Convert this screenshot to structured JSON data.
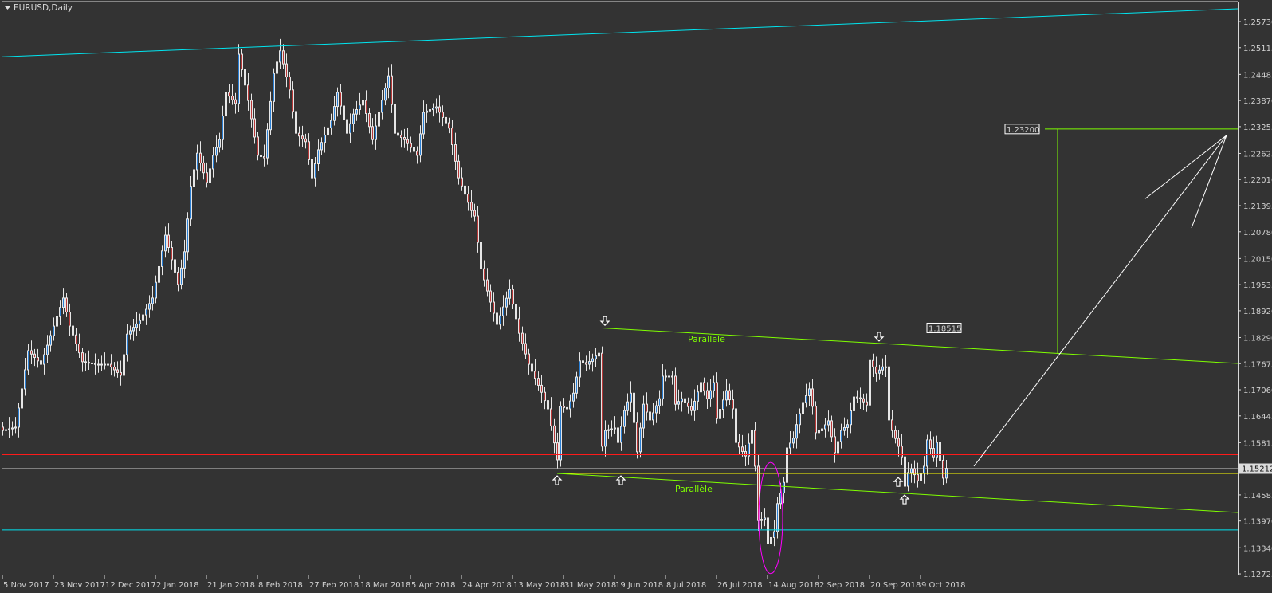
{
  "header": {
    "title": "EURUSD,Daily",
    "menu_icon": "triangle-down-icon"
  },
  "colors": {
    "background": "#333333",
    "axis": "#d8d8d8",
    "bull_fill": "#2a7fd4",
    "bear_fill": "#b83838",
    "candle_outline": "#e6e6e6",
    "trendline_cyan": "#00e5f0",
    "support_red": "#ff1a1a",
    "bid_gray": "#808080",
    "level_yellow": "#ffff00",
    "channel_green": "#7fff00",
    "ellipse_magenta": "#ff00ff",
    "arrow_white": "#ffffff"
  },
  "chart_data": {
    "type": "candlestick",
    "symbol": "EURUSD",
    "timeframe": "Daily",
    "ylim": [
      1.12725,
      1.2573
    ],
    "y_ticks": [
      "1.25730",
      "1.25115",
      "1.24485",
      "1.23870",
      "1.23255",
      "1.22625",
      "1.22010",
      "1.21395",
      "1.20780",
      "1.20150",
      "1.19535",
      "1.18920",
      "1.18290",
      "1.17675",
      "1.17060",
      "1.16445",
      "1.15815",
      "1.14585",
      "1.13970",
      "1.13340",
      "1.12725"
    ],
    "x_ticks": [
      {
        "bar": 0,
        "label": "5 Nov 2017"
      },
      {
        "bar": 16,
        "label": "23 Nov 2017"
      },
      {
        "bar": 32,
        "label": "12 Dec 2017"
      },
      {
        "bar": 48,
        "label": "2 Jan 2018"
      },
      {
        "bar": 64,
        "label": "21 Jan 2018"
      },
      {
        "bar": 80,
        "label": "8 Feb 2018"
      },
      {
        "bar": 96,
        "label": "27 Feb 2018"
      },
      {
        "bar": 112,
        "label": "18 Mar 2018"
      },
      {
        "bar": 128,
        "label": "5 Apr 2018"
      },
      {
        "bar": 144,
        "label": "24 Apr 2018"
      },
      {
        "bar": 160,
        "label": "13 May 2018"
      },
      {
        "bar": 176,
        "label": "31 May 2018"
      },
      {
        "bar": 192,
        "label": "19 Jun 2018"
      },
      {
        "bar": 208,
        "label": "8 Jul 2018"
      },
      {
        "bar": 224,
        "label": "26 Jul 2018"
      },
      {
        "bar": 240,
        "label": "14 Aug 2018"
      },
      {
        "bar": 256,
        "label": "2 Sep 2018"
      },
      {
        "bar": 272,
        "label": "20 Sep 2018"
      },
      {
        "bar": 288,
        "label": "9 Oct 2018"
      }
    ],
    "bars_total": 297,
    "close_keypoints": [
      [
        0,
        1.161
      ],
      [
        4,
        1.1618
      ],
      [
        8,
        1.1798
      ],
      [
        12,
        1.1766
      ],
      [
        16,
        1.1856
      ],
      [
        19,
        1.1922
      ],
      [
        21,
        1.1856
      ],
      [
        25,
        1.1772
      ],
      [
        29,
        1.1766
      ],
      [
        33,
        1.1766
      ],
      [
        37,
        1.174
      ],
      [
        39,
        1.1837
      ],
      [
        43,
        1.1869
      ],
      [
        47,
        1.1922
      ],
      [
        51,
        1.207
      ],
      [
        55,
        1.1954
      ],
      [
        57,
        1.2031
      ],
      [
        59,
        1.2185
      ],
      [
        61,
        1.2263
      ],
      [
        64,
        1.2194
      ],
      [
        66,
        1.2258
      ],
      [
        68,
        1.2295
      ],
      [
        70,
        1.2406
      ],
      [
        73,
        1.238
      ],
      [
        74,
        1.2496
      ],
      [
        77,
        1.2387
      ],
      [
        80,
        1.2258
      ],
      [
        82,
        1.2252
      ],
      [
        85,
        1.2451
      ],
      [
        87,
        1.2504
      ],
      [
        90,
        1.2412
      ],
      [
        92,
        1.231
      ],
      [
        95,
        1.229
      ],
      [
        97,
        1.2205
      ],
      [
        99,
        1.2271
      ],
      [
        103,
        1.234
      ],
      [
        105,
        1.2406
      ],
      [
        108,
        1.231
      ],
      [
        110,
        1.2355
      ],
      [
        113,
        1.2387
      ],
      [
        116,
        1.2295
      ],
      [
        118,
        1.2359
      ],
      [
        121,
        1.2445
      ],
      [
        123,
        1.231
      ],
      [
        126,
        1.2295
      ],
      [
        130,
        1.2258
      ],
      [
        132,
        1.2359
      ],
      [
        136,
        1.2372
      ],
      [
        140,
        1.2322
      ],
      [
        143,
        1.2205
      ],
      [
        147,
        1.2128
      ],
      [
        148,
        1.2115
      ],
      [
        150,
        1.1991
      ],
      [
        155,
        1.186
      ],
      [
        159,
        1.1942
      ],
      [
        162,
        1.1839
      ],
      [
        165,
        1.1766
      ],
      [
        169,
        1.17
      ],
      [
        171,
        1.1661
      ],
      [
        174,
        1.1541
      ],
      [
        175,
        1.1667
      ],
      [
        177,
        1.1661
      ],
      [
        179,
        1.1698
      ],
      [
        181,
        1.1774
      ],
      [
        183,
        1.1766
      ],
      [
        185,
        1.1779
      ],
      [
        187,
        1.1792
      ],
      [
        188,
        1.1573
      ],
      [
        189,
        1.161
      ],
      [
        192,
        1.1616
      ],
      [
        193,
        1.1582
      ],
      [
        195,
        1.1657
      ],
      [
        197,
        1.1698
      ],
      [
        199,
        1.156
      ],
      [
        201,
        1.1672
      ],
      [
        203,
        1.1635
      ],
      [
        206,
        1.1685
      ],
      [
        207,
        1.1738
      ],
      [
        210,
        1.1738
      ],
      [
        211,
        1.1672
      ],
      [
        213,
        1.1685
      ],
      [
        216,
        1.1657
      ],
      [
        219,
        1.1723
      ],
      [
        221,
        1.1685
      ],
      [
        223,
        1.1723
      ],
      [
        224,
        1.1638
      ],
      [
        227,
        1.1704
      ],
      [
        229,
        1.1661
      ],
      [
        230,
        1.1582
      ],
      [
        233,
        1.155
      ],
      [
        235,
        1.161
      ],
      [
        236,
        1.1526
      ],
      [
        237,
        1.1398
      ],
      [
        239,
        1.1404
      ],
      [
        240,
        1.1344
      ],
      [
        242,
        1.1372
      ],
      [
        243,
        1.1438
      ],
      [
        245,
        1.1488
      ],
      [
        246,
        1.1569
      ],
      [
        248,
        1.1592
      ],
      [
        249,
        1.1624
      ],
      [
        251,
        1.1676
      ],
      [
        253,
        1.1708
      ],
      [
        254,
        1.1667
      ],
      [
        255,
        1.1605
      ],
      [
        257,
        1.1614
      ],
      [
        259,
        1.1633
      ],
      [
        261,
        1.1558
      ],
      [
        263,
        1.161
      ],
      [
        265,
        1.1624
      ],
      [
        267,
        1.1689
      ],
      [
        269,
        1.1685
      ],
      [
        271,
        1.167
      ],
      [
        272,
        1.1775
      ],
      [
        274,
        1.1745
      ],
      [
        276,
        1.176
      ],
      [
        277,
        1.176
      ],
      [
        278,
        1.1635
      ],
      [
        279,
        1.161
      ],
      [
        281,
        1.1573
      ],
      [
        282,
        1.1548
      ],
      [
        283,
        1.1479
      ],
      [
        284,
        1.1511
      ],
      [
        285,
        1.152
      ],
      [
        287,
        1.1492
      ],
      [
        289,
        1.1526
      ],
      [
        290,
        1.1588
      ],
      [
        292,
        1.1548
      ],
      [
        293,
        1.1582
      ],
      [
        295,
        1.1498
      ],
      [
        296,
        1.1521
      ]
    ],
    "current_price": "1.15212",
    "objects": {
      "cyan_trendline": {
        "from": [
          0,
          1.249
        ],
        "to": [
          387.5,
          1.2603
        ]
      },
      "cyan_level": {
        "price": 1.1376
      },
      "red_level": {
        "price": 1.1553
      },
      "yellow_level": {
        "from_bar": 176,
        "price": 1.1509
      },
      "upper_channel_level": {
        "from_bar": 188,
        "price": 1.18515,
        "label": "1.18515",
        "label_bar": 290
      },
      "upper_channel": {
        "from": [
          188,
          1.18515
        ],
        "to": [
          387.5,
          1.1768
        ],
        "label": "Parallele",
        "label_at": [
          215,
          1.1826
        ]
      },
      "lower_channel": {
        "from": [
          174,
          1.1509
        ],
        "to": [
          387.5,
          1.1417
        ],
        "label": "Parallèle",
        "label_at": [
          211,
          1.1473
        ]
      },
      "target_level": {
        "from_bar": 327,
        "price": 1.232,
        "label": "1.23200"
      },
      "target_vertical": {
        "bar": 331,
        "from_price": 1.232,
        "to_price": 1.1792
      },
      "projection_arrow": {
        "from": [
          304.75,
          1.1526
        ],
        "to": [
          384,
          1.2305
        ],
        "heads": [
          [
            358.5,
            1.2156
          ],
          [
            373,
            1.2087
          ]
        ]
      },
      "highlight_ellipse": {
        "center": [
          241,
          1.1404
        ],
        "half_width_bars": 3.75,
        "half_height_price": 0.0131
      },
      "markers": [
        {
          "type": "down",
          "bar": 189,
          "price": 1.1869
        },
        {
          "type": "up",
          "bar": 174,
          "price": 1.1492
        },
        {
          "type": "up",
          "bar": 194,
          "price": 1.1492
        },
        {
          "type": "down",
          "bar": 275,
          "price": 1.1832
        },
        {
          "type": "up",
          "bar": 281,
          "price": 1.1488
        },
        {
          "type": "up",
          "bar": 283,
          "price": 1.1447
        }
      ]
    }
  }
}
